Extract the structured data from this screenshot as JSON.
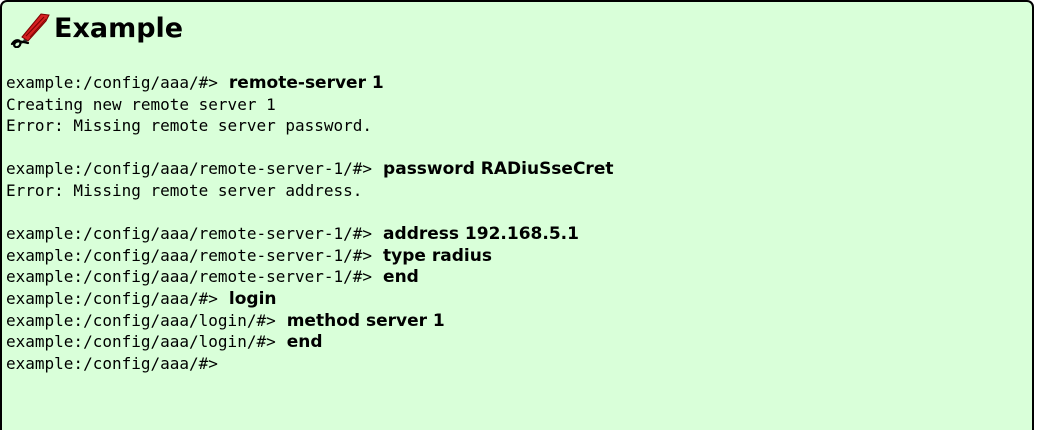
{
  "header": {
    "title": "Example",
    "icon": "pen-icon"
  },
  "colors": {
    "box_background": "#d9ffd9",
    "box_border": "#000000",
    "icon_red": "#d42020"
  },
  "console": {
    "lines": [
      {
        "prompt": "example:/config/aaa/#>",
        "cmd": "remote-server 1"
      },
      {
        "text": "Creating new remote server 1"
      },
      {
        "text": "Error: Missing remote server password."
      },
      {
        "text": ""
      },
      {
        "prompt": "example:/config/aaa/remote-server-1/#>",
        "cmd": "password RADiuSseCret"
      },
      {
        "text": "Error: Missing remote server address."
      },
      {
        "text": ""
      },
      {
        "prompt": "example:/config/aaa/remote-server-1/#>",
        "cmd": "address 192.168.5.1"
      },
      {
        "prompt": "example:/config/aaa/remote-server-1/#>",
        "cmd": "type radius"
      },
      {
        "prompt": "example:/config/aaa/remote-server-1/#>",
        "cmd": "end"
      },
      {
        "prompt": "example:/config/aaa/#>",
        "cmd": "login"
      },
      {
        "prompt": "example:/config/aaa/login/#>",
        "cmd": "method server 1"
      },
      {
        "prompt": "example:/config/aaa/login/#>",
        "cmd": "end"
      },
      {
        "prompt": "example:/config/aaa/#>",
        "cmd": ""
      }
    ]
  }
}
